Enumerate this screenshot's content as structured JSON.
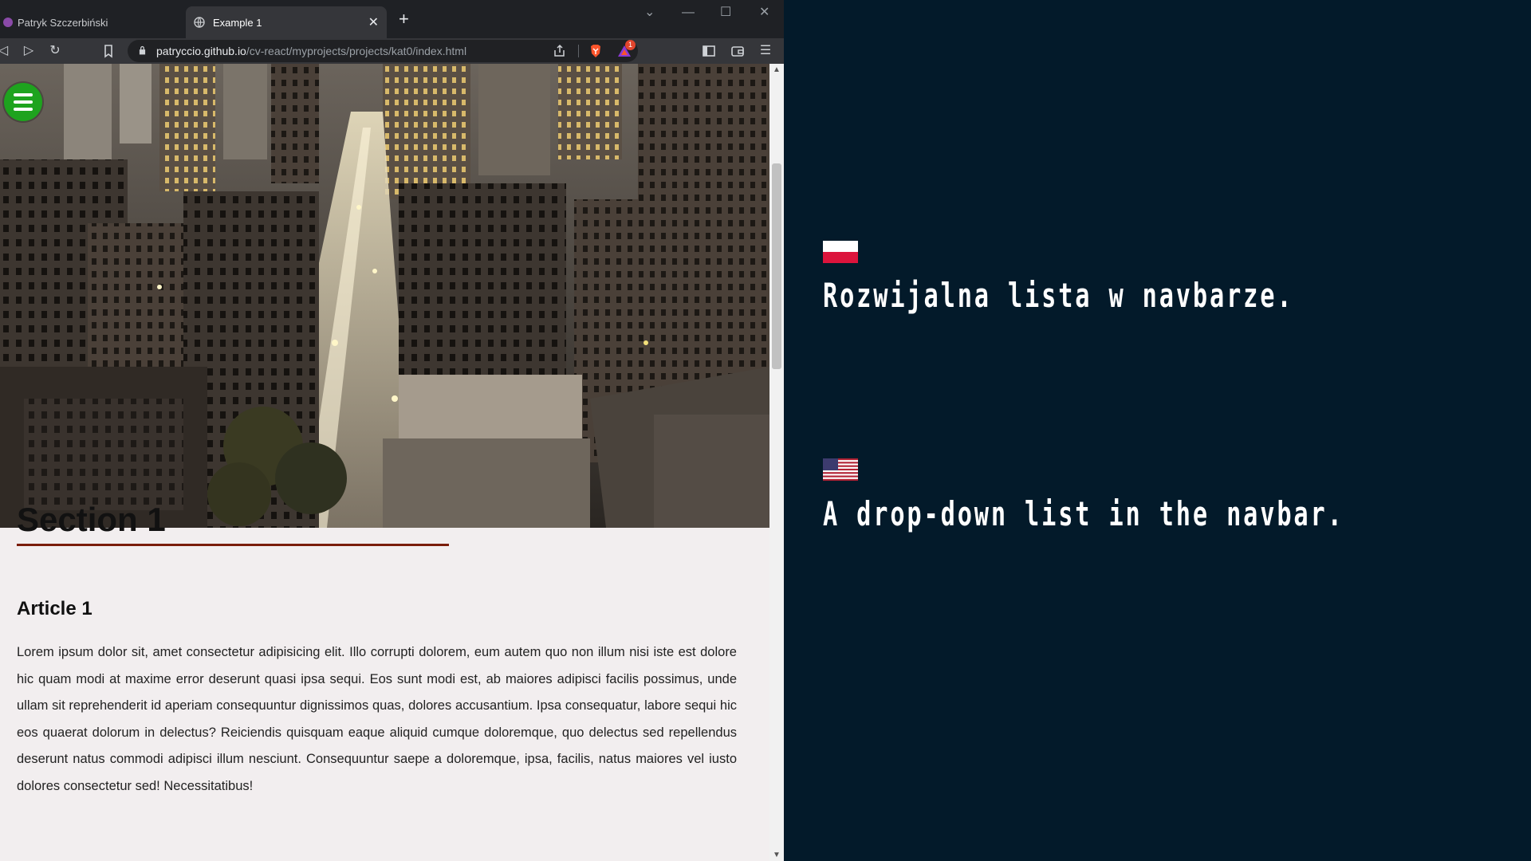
{
  "browser": {
    "tabs": [
      {
        "label": "Patryk Szczerbiński",
        "active": false
      },
      {
        "label": "Example 1",
        "active": true
      }
    ],
    "url": {
      "host": "patryccio.github.io",
      "path": "/cv-react/myprojects/projects/kat0/index.html"
    },
    "rewards_count": "1"
  },
  "page": {
    "section_title": "Section 1",
    "article_title": "Article 1",
    "article_text": "Lorem ipsum dolor sit, amet consectetur adipisicing elit. Illo corrupti dolorem, eum autem quo non illum nisi iste est dolore hic quam modi at maxime error deserunt quasi ipsa sequi. Eos sunt modi est, ab maiores adipisci facilis possimus, unde ullam sit reprehenderit id aperiam consequuntur dignissimos quas, dolores accusantium. Ipsa consequatur, labore sequi hic eos quaerat dolorum in delectus? Reiciendis quisquam eaque aliquid cumque doloremque, quo delectus sed repellendus deserunt natus commodi adipisci illum nesciunt. Consequuntur saepe a doloremque, ipsa, facilis, natus maiores vel iusto dolores consectetur sed! Necessitatibus!"
  },
  "captions": {
    "pl": "Rozwijalna lista w navbarze.",
    "en": "A drop-down list in the navbar."
  },
  "colors": {
    "panel_bg": "#031a2a",
    "menu_button": "#1ea31e",
    "underline": "#7a1c0a",
    "page_bg": "#f2eeef"
  }
}
